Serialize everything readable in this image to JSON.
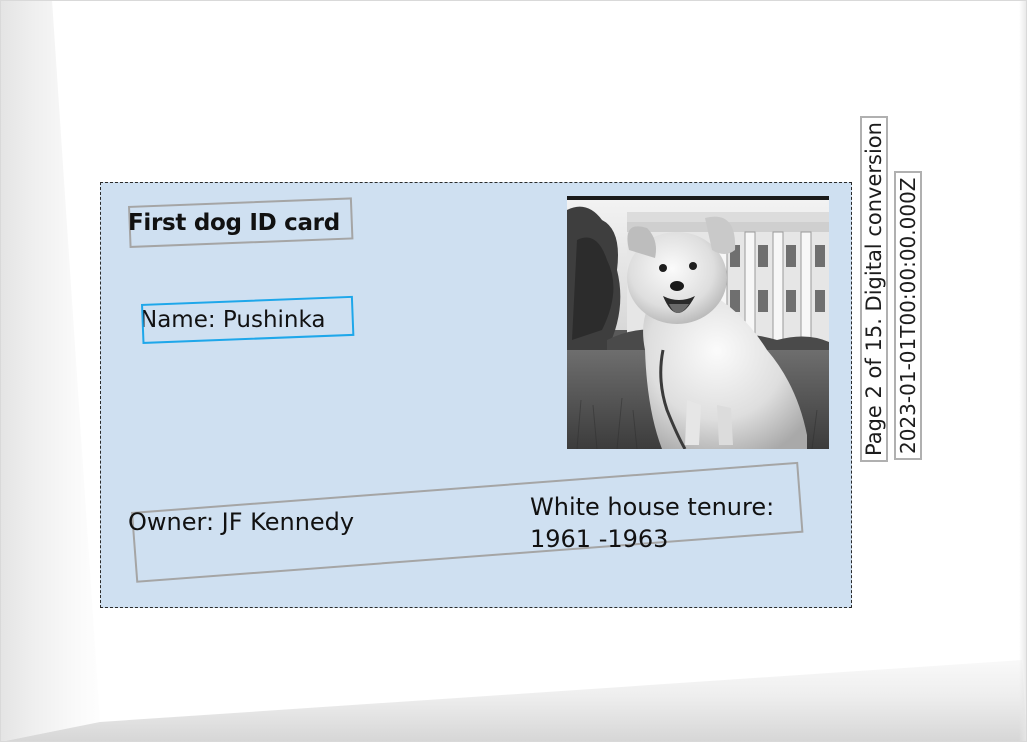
{
  "card": {
    "title": "First dog ID card",
    "name": "Name: Pushinka",
    "owner": "Owner: JF Kennedy",
    "tenure_label": "White house tenure:",
    "tenure_years": "1961 -1963"
  },
  "stamp": {
    "page_info": "Page 2 of 15. Digital conversion",
    "timestamp": "2023-01-01T00:00:00.000Z"
  },
  "colors": {
    "card_background": "#cfe0f1",
    "highlight_box": "#1ea7ea",
    "annotation_box": "#a5a5a5"
  },
  "photo": {
    "subject": "white fluffy dog sitting on grass in front of the White House"
  }
}
